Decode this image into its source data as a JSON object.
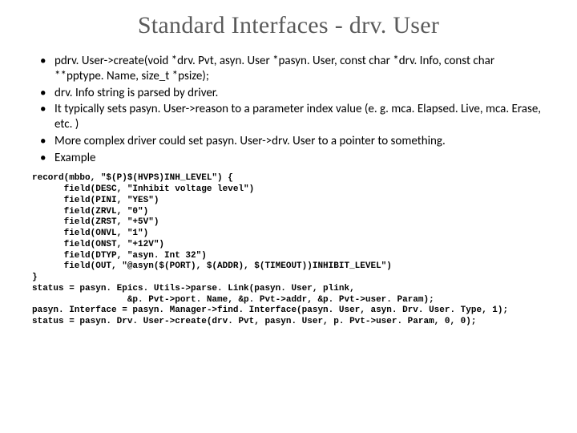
{
  "title": "Standard Interfaces - drv. User",
  "bullets": [
    "pdrv. User->create(void *drv. Pvt, asyn. User *pasyn. User, const char *drv. Info, const char **pptype. Name, size_t *psize);",
    "drv. Info string is parsed by driver.",
    "It typically sets pasyn. User->reason to a parameter index value (e. g. mca. Elapsed. Live, mca. Erase, etc. )",
    "More complex driver could set pasyn. User->drv. User to a pointer to something.",
    "Example"
  ],
  "code": "record(mbbo, \"$(P)$(HVPS)INH_LEVEL\") {\n      field(DESC, \"Inhibit voltage level\")\n      field(PINI, \"YES\")\n      field(ZRVL, \"0\")\n      field(ZRST, \"+5V\")\n      field(ONVL, \"1\")\n      field(ONST, \"+12V\")\n      field(DTYP, \"asyn. Int 32\")\n      field(OUT, \"@asyn($(PORT), $(ADDR), $(TIMEOUT))INHIBIT_LEVEL\")\n}\nstatus = pasyn. Epics. Utils->parse. Link(pasyn. User, plink,\n                  &p. Pvt->port. Name, &p. Pvt->addr, &p. Pvt->user. Param);\npasyn. Interface = pasyn. Manager->find. Interface(pasyn. User, asyn. Drv. User. Type, 1);\nstatus = pasyn. Drv. User->create(drv. Pvt, pasyn. User, p. Pvt->user. Param, 0, 0);"
}
